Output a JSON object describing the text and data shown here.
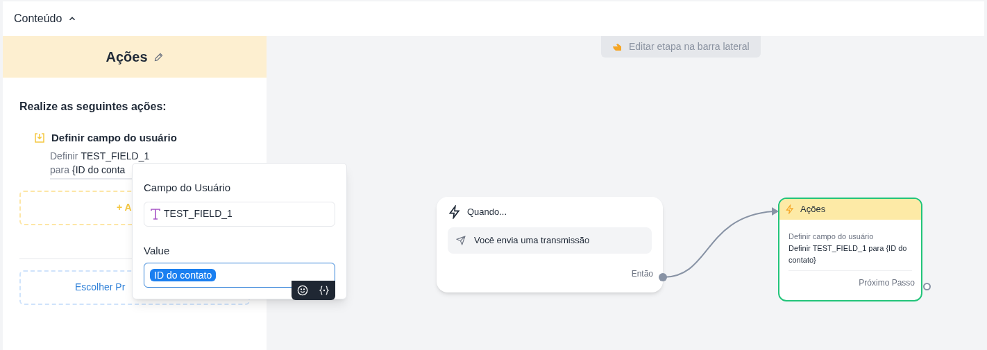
{
  "header": {
    "title": "Conteúdo",
    "expanded": true
  },
  "sidebar": {
    "title": "Ações",
    "instructions": "Realize as seguintes ações:",
    "action": {
      "title": "Definir campo do usuário",
      "lines": [
        {
          "prefix": "Definir",
          "value": "TEST_FIELD_1"
        },
        {
          "prefix": "para",
          "value": "{ID do conta"
        }
      ]
    },
    "add_button": "+ A",
    "choose_button": "Escolher Pr"
  },
  "popover": {
    "field_label": "Campo do Usuário",
    "field_value": "TEST_FIELD_1",
    "value_label": "Value",
    "value_token": "ID do contato"
  },
  "canvas": {
    "hint": "Editar etapa na barra lateral",
    "trigger_node": {
      "title": "Quando...",
      "event": "Você envia uma transmissão",
      "output": "Então"
    },
    "action_node": {
      "title": "Ações",
      "subtitle": "Definir campo do usuário",
      "description": "Definir TEST_FIELD_1 para {ID do contato}",
      "output": "Próximo Passo"
    }
  }
}
